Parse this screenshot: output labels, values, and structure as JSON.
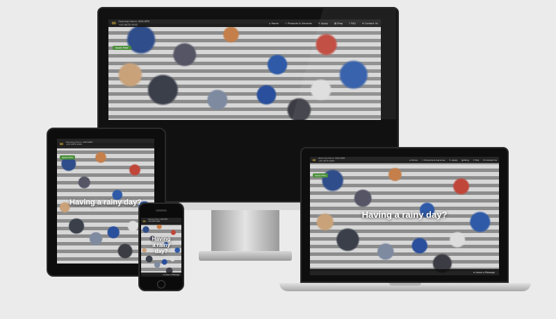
{
  "site": {
    "logo": "∞",
    "contact_line_1": "Opening Hours: 9AM-6PM",
    "contact_line_2": "+65 6878 9995"
  },
  "nav": [
    {
      "icon": "home-icon",
      "glyph": "⌂",
      "label": "Home"
    },
    {
      "icon": "star-icon",
      "glyph": "☆",
      "label": "Products & Services"
    },
    {
      "icon": "edit-icon",
      "glyph": "✎",
      "label": "Apply"
    },
    {
      "icon": "blog-icon",
      "glyph": "▤",
      "label": "Blog"
    },
    {
      "icon": "question-icon",
      "glyph": "?",
      "label": "FAQ"
    },
    {
      "icon": "mail-icon",
      "glyph": "✉",
      "label": "Contact Us"
    }
  ],
  "hero": {
    "button_label": "Apply Now",
    "headline": "Having a rainy day?",
    "headline_phone": [
      "Having",
      "a rainy",
      "day?"
    ]
  },
  "message_bar": {
    "label": "Leave a Message"
  }
}
